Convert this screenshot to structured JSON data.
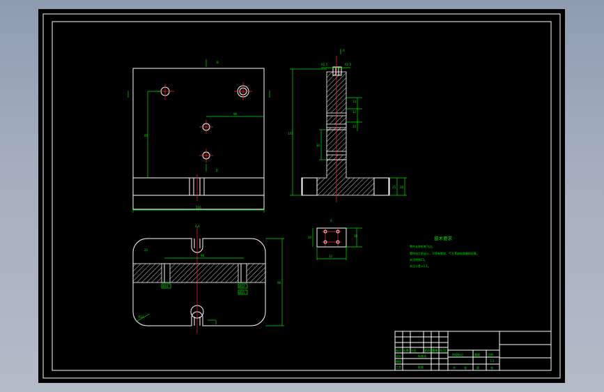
{
  "drawing": {
    "section_labels": {
      "top_view_section": "B",
      "side_view_section": "A",
      "bottom_view_section": "A-A",
      "detail_view": "A"
    },
    "dimensions": {
      "top_width": "216",
      "top_height": "85",
      "top_hole_offset": "96",
      "side_total_height": "141",
      "side_top_left": "R2.5",
      "side_top_right": "R2.5",
      "side_mid_1": "13",
      "side_mid_2": "12",
      "side_mid_3": "10",
      "side_slot": "30",
      "side_base_1": "25",
      "side_base_2": "38",
      "bottom_width": "96",
      "bottom_height": "98",
      "bottom_radius": "R15",
      "bottom_hole_left": "Ø10",
      "bottom_hole_right_1": "Ø12",
      "bottom_hole_right_2": "Ø15",
      "detail_h": "20",
      "detail_w": "32",
      "detail_r": "10"
    },
    "tech_requirements": {
      "title": "技术要求",
      "lines": [
        "零件去除毛刺飞边。",
        "零件加工前退火，不得有裂纹、气孔等缺陷和磨损现象。",
        "未注倒角C1。",
        "未注公差±0.1。"
      ]
    },
    "title_block": {
      "cells": [
        "标记",
        "处数",
        "分区",
        "更改文件号",
        "签名",
        "年月日",
        "设计",
        "标准化",
        "阶段标记",
        "重量",
        "比例",
        "审核",
        "工艺",
        "批准",
        "共",
        "张",
        "第",
        "张",
        "1:1"
      ]
    }
  }
}
